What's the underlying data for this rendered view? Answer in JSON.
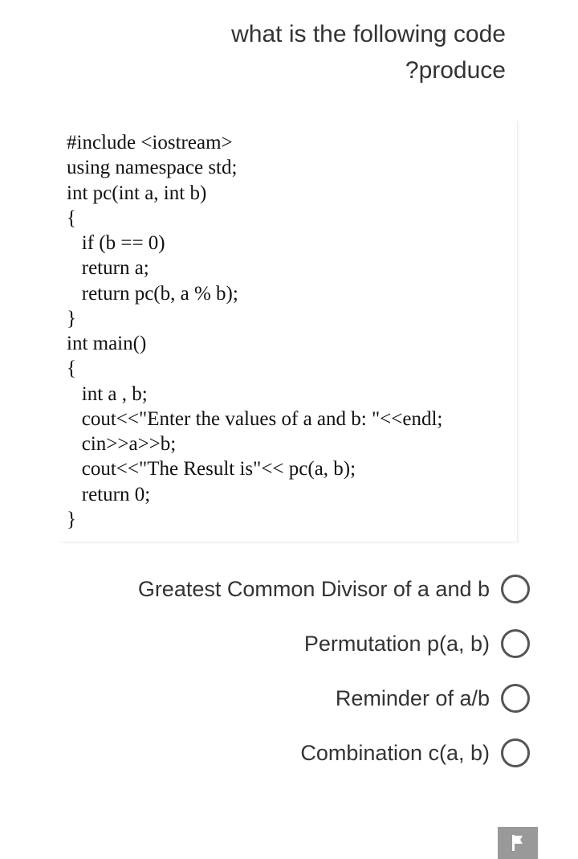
{
  "question": {
    "line1": "what is the following code",
    "line2": "?produce"
  },
  "code": "#include <iostream>\nusing namespace std;\nint pc(int a, int b)\n{\n   if (b == 0)\n   return a;\n   return pc(b, a % b);\n}\nint main()\n{\n   int a , b;\n   cout<<\"Enter the values of a and b: \"<<endl;\n   cin>>a>>b;\n   cout<<\"The Result is\"<< pc(a, b);\n   return 0;\n}",
  "options": [
    {
      "label": "Greatest Common Divisor of a and b"
    },
    {
      "label": "Permutation p(a, b)"
    },
    {
      "label": "Reminder of a/b"
    },
    {
      "label": "Combination c(a, b)"
    }
  ],
  "flag_icon": "flag"
}
